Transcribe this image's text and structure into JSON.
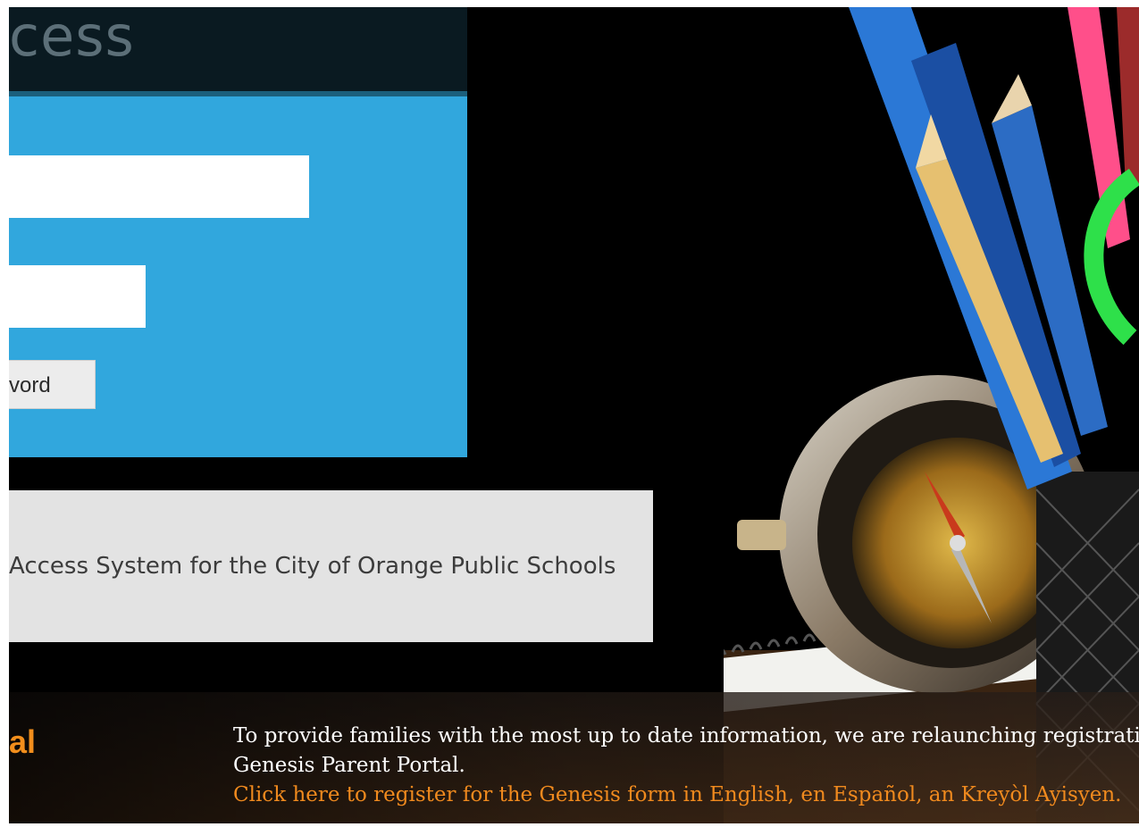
{
  "header": {
    "title_fragment": "cess"
  },
  "login": {
    "password_button_label": "vord"
  },
  "info": {
    "system_text": "Access System for the City of Orange Public Schools"
  },
  "portal_label": "al",
  "notice": {
    "line1": "To provide families with the most up to date information, we are relaunching registration",
    "line2": "Genesis Parent Portal.",
    "link_text": "Click here to register for the Genesis form in English, en Español, an Kreyòl Ayisyen."
  },
  "colors": {
    "accent_orange": "#f08a1e",
    "panel_blue": "#31a7dd"
  }
}
